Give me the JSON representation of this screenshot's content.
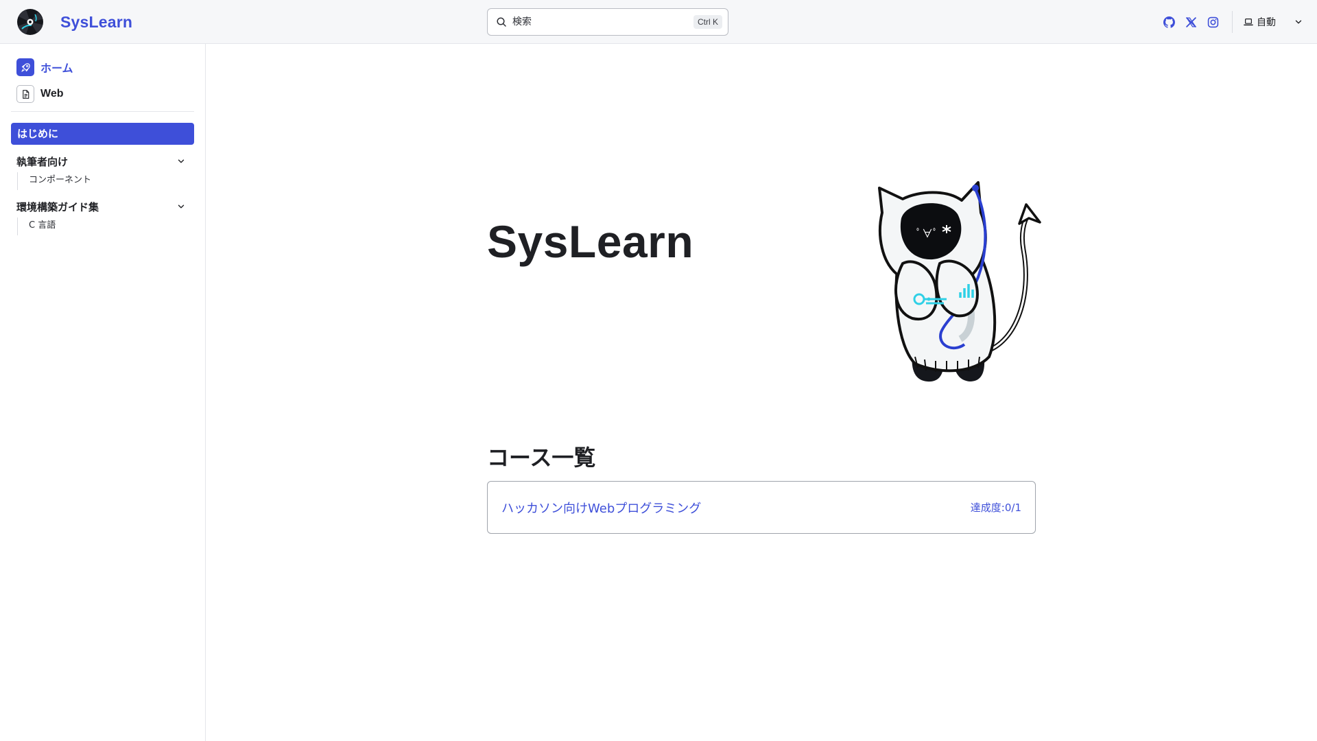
{
  "header": {
    "site_name": "SysLearn",
    "search_placeholder": "検索",
    "search_shortcut": "Ctrl K",
    "social_icons": [
      "github-icon",
      "x-icon",
      "instagram-icon"
    ],
    "theme_label": "自動"
  },
  "sidebar": {
    "top_links": [
      {
        "label": "ホーム",
        "icon": "rocket-icon",
        "active": true
      },
      {
        "label": "Web",
        "icon": "document-icon",
        "active": false
      }
    ],
    "active_item": "はじめに",
    "groups": [
      {
        "title": "執筆者向け",
        "children": [
          "コンポーネント"
        ]
      },
      {
        "title": "環境構築ガイド集",
        "children": [
          "C 言語"
        ]
      }
    ]
  },
  "main": {
    "hero_title": "SysLearn",
    "section_title": "コース一覧",
    "courses": [
      {
        "title": "ハッカソン向けWebプログラミング",
        "progress": "達成度:0/1"
      }
    ]
  },
  "colors": {
    "accent": "#3e4fd9",
    "header_bg": "#f6f7f9",
    "border": "#e4e6ea",
    "text": "#1f2024"
  }
}
